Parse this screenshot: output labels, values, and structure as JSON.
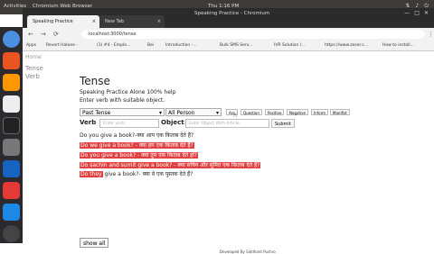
{
  "system_bar": {
    "activities": "Activities",
    "app_name": "Chromium Web Browser",
    "clock": "Thu 1:16 PM"
  },
  "window": {
    "title": "Speaking Practice - Chromium"
  },
  "tabs": [
    {
      "label": "Speaking Practice",
      "close": "×"
    },
    {
      "label": "New Tab",
      "close": "×"
    }
  ],
  "address_bar": {
    "url": "localhost:3000/tense"
  },
  "bookmarks": [
    "Apps",
    "Revert Haloee -",
    "(1) #4 - Emplo...",
    "Bei",
    "Introduction -...",
    "Bulk SMS Serv...",
    "IVR Solution l...",
    "https://www.zoser.c...",
    "How to install..."
  ],
  "page": {
    "breadcrumb": "Home",
    "sidebar": [
      "Tense",
      "Verb"
    ],
    "title": "Tense",
    "subtitle": "Speaking Practice Alone 100% help",
    "instruction": "Enter verb with suitable object.",
    "tense_select": "Past Tense",
    "person_select": "All Person",
    "sentence_buttons": [
      "Ass",
      "Question",
      "Positive",
      "Negative",
      "Inform",
      "Manifist"
    ],
    "verb_label": "Verb",
    "verb_placeholder": "Enter verb",
    "object_label": "Object",
    "object_placeholder": "Enter Object With Article",
    "submit_label": "Submit",
    "questions": [
      {
        "text": "Do you give a book?-क्या आप एक किताब देते हैं?",
        "highlight": false
      },
      {
        "text": "Do we give a book? - क्या हम एक किताब देते हैं?",
        "highlight": true
      },
      {
        "text": "Do you give a book? - क्या तुम एक किताब देते हो?",
        "highlight": true
      },
      {
        "text": "Do sachin and sumit give a book? - क्या सचिन और सुमित एक किताब देते हैं?",
        "highlight": true
      },
      {
        "text": "Do they",
        "rest": " give a book?- क्या वे एक पुस्तक देते हैं?",
        "highlight": "partial"
      }
    ],
    "show_all_label": "show all",
    "footer": "Developed By Siddhant Pushro"
  }
}
